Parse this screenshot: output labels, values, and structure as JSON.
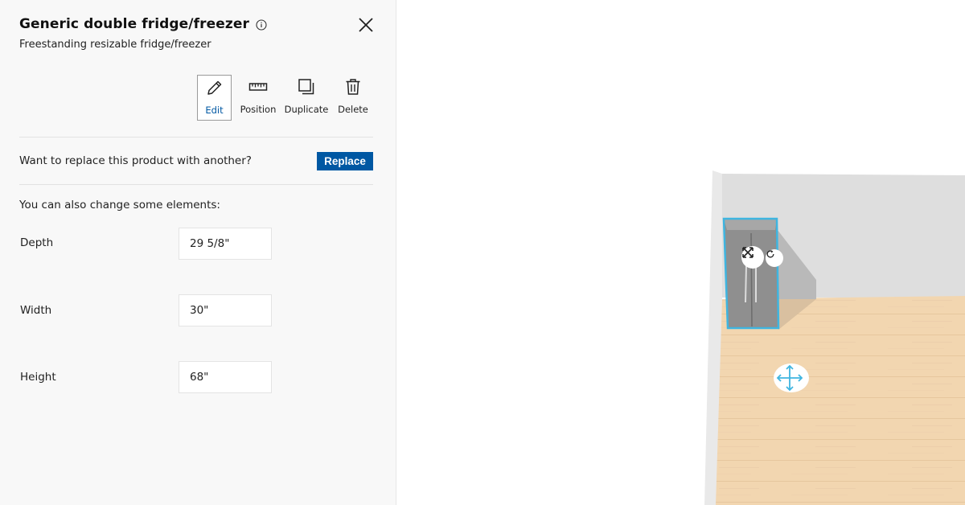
{
  "panel": {
    "title": "Generic double fridge/freezer",
    "subtitle": "Freestanding resizable fridge/freezer",
    "info_icon": "info-circle-icon",
    "close_icon": "close-icon"
  },
  "toolbar": {
    "items": [
      {
        "label": "Edit",
        "icon": "pencil-icon",
        "active": true
      },
      {
        "label": "Position",
        "icon": "ruler-icon",
        "active": false
      },
      {
        "label": "Duplicate",
        "icon": "duplicate-icon",
        "active": false
      },
      {
        "label": "Delete",
        "icon": "trash-icon",
        "active": false
      }
    ]
  },
  "replace": {
    "text": "Want to replace this product with another?",
    "button_label": "Replace"
  },
  "elements": {
    "intro": "You can also change some elements:",
    "fields": [
      {
        "label": "Depth",
        "value": "29 5/8\""
      },
      {
        "label": "Width",
        "value": "30\""
      },
      {
        "label": "Height",
        "value": "68\""
      }
    ]
  },
  "viewport": {
    "selection_color": "#3fb5e0",
    "handles": [
      "resize-handle-icon",
      "rotate-handle-icon",
      "move-handle-icon"
    ]
  }
}
